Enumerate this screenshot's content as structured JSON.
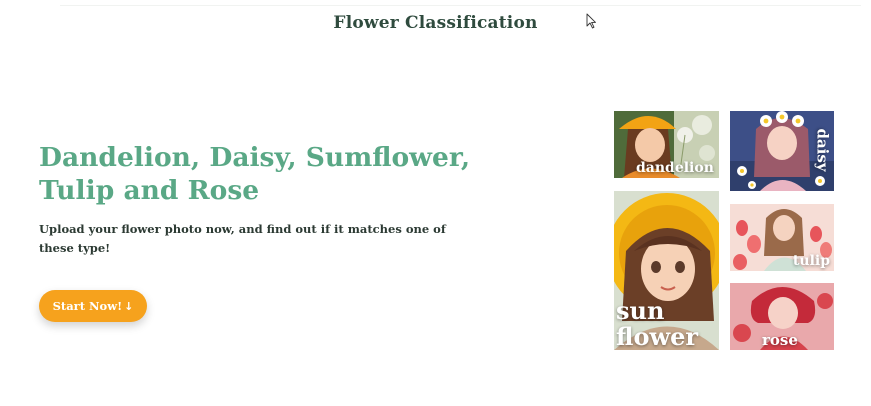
{
  "header": {
    "title": "Flower Classification"
  },
  "hero": {
    "heading": "Dandelion, Daisy, Sumflower, Tulip and Rose",
    "subtitle": "Upload your flower photo now, and find out if it matches one of these type!",
    "button_label": "Start Now!",
    "button_icon": "↓"
  },
  "gallery": {
    "cards": [
      {
        "id": "dandelion",
        "label": "dandelion"
      },
      {
        "id": "daisy",
        "label": "daisy"
      },
      {
        "id": "sunflower",
        "label_line1": "sun",
        "label_line2": "flower"
      },
      {
        "id": "tulip",
        "label": "tulip"
      },
      {
        "id": "rose",
        "label": "rose"
      }
    ]
  },
  "colors": {
    "title": "#2f4b3e",
    "heading": "#5aa886",
    "subtitle": "#2c3a33",
    "button_bg": "#f6a21d",
    "button_text": "#ffffff"
  }
}
